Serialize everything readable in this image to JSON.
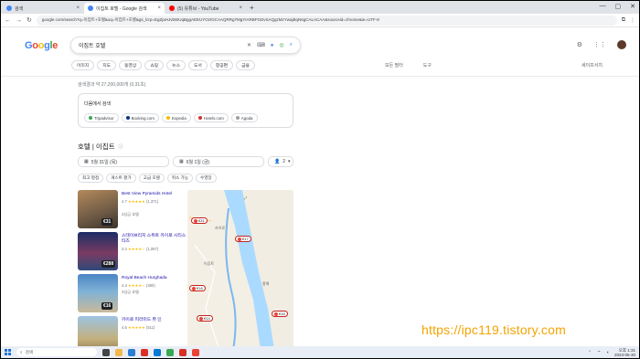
{
  "tabs": [
    {
      "label": "검색",
      "fav": "#4285f4",
      "active": false
    },
    {
      "label": "이집트 호텔 - Google 검색",
      "fav": "#4285f4",
      "active": true
    },
    {
      "label": "(5) 유튜브 - YouTube",
      "fav": "#ff0000",
      "active": false
    }
  ],
  "window": {
    "new_tab": "+",
    "minimize": "—",
    "maximize": "▢",
    "close": "✕"
  },
  "address": {
    "url": "google.com/search?q=이집트+호텔&oq=이집트+호텔&gs_lcrp=EgZjaHJvbWUqBggAEEUYOzIGCAAQRRg7MgYIARBFGDvSAQgzMzYwajBqN6gCALACAA&sourceid=chrome&ie=UTF-8"
  },
  "google": {
    "logo": [
      "G",
      "o",
      "o",
      "g",
      "l",
      "e"
    ],
    "query": "이집트 호텔"
  },
  "chips": [
    "이미지",
    "지도",
    "동영상",
    "쇼핑",
    "뉴스",
    "도서",
    "항공편",
    "금융"
  ],
  "right_filters": [
    "모든 필터",
    "도구"
  ],
  "safe_search": "세이프서치",
  "stats": "검색결과 약 27,200,000개 (0.31초)",
  "card": {
    "title": "다음에서 검색",
    "providers": [
      {
        "label": "Tripadvisor",
        "color": "#34a853"
      },
      {
        "label": "Booking.com",
        "color": "#003580"
      },
      {
        "label": "Expedia",
        "color": "#fbbc04"
      },
      {
        "label": "Hotels.com",
        "color": "#d32f2f"
      },
      {
        "label": "Agoda",
        "color": "#9e9e9e"
      }
    ]
  },
  "section": {
    "title": "호텔 | 이집트",
    "info": "ⓘ"
  },
  "dates": {
    "checkin": "5월 31일 (목)",
    "checkout": "6월 1일 (금)",
    "guests": "2"
  },
  "filters": [
    "최고 평점",
    "게스트 평가",
    "고급 호텔",
    "취소 가능",
    "수영장"
  ],
  "hotels": [
    {
      "name": "Best View Pyramids Hotel",
      "rating": "4.7",
      "stars": "★★★★★",
      "reviews": "(1,371)",
      "sub": "3성급 호텔",
      "price": "€31"
    },
    {
      "name": "스테이브리지 스위트 카이로 시티스타즈",
      "rating": "4.4",
      "stars": "★★★★☆",
      "reviews": "(1,087)",
      "sub": "",
      "price": "€288"
    },
    {
      "name": "Royal Beach Hurghada",
      "rating": "4.3",
      "stars": "★★★★☆",
      "reviews": "(380)",
      "sub": "3성급 호텔",
      "price": "€16"
    },
    {
      "name": "카이로 피라미드 뷰 인",
      "rating": "4.6",
      "stars": "★★★★★",
      "reviews": "(511)",
      "sub": "",
      "price": ""
    }
  ],
  "map": {
    "pins": [
      "€31",
      "€17",
      "€16",
      "€14",
      "€16"
    ],
    "labels": [
      "카이로",
      "이집트",
      "홍해"
    ]
  },
  "watermark": "https://ipc119.tistory.com",
  "taskbar": {
    "search": "검색",
    "time": "오후 1:31",
    "date": "2023-05-30"
  }
}
